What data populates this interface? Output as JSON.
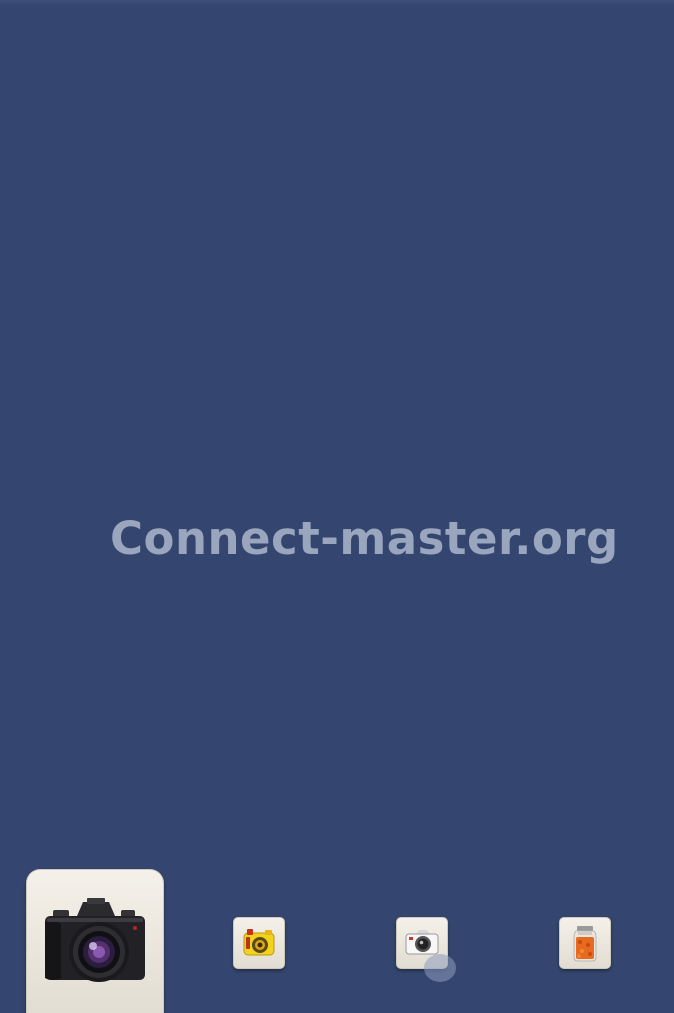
{
  "watermark": {
    "text": "Connect-master.org"
  },
  "tray": {
    "selected_item": "slr-camera",
    "items": [
      {
        "icon": "slr-camera-icon",
        "selected": true
      },
      {
        "icon": "yellow-camera-icon",
        "selected": false
      },
      {
        "icon": "white-camera-icon",
        "selected": false
      },
      {
        "icon": "orange-jar-icon",
        "selected": false
      }
    ]
  },
  "colors": {
    "background": "#34466f",
    "tile": "#efebe2",
    "watermark": "#9aa6be"
  }
}
